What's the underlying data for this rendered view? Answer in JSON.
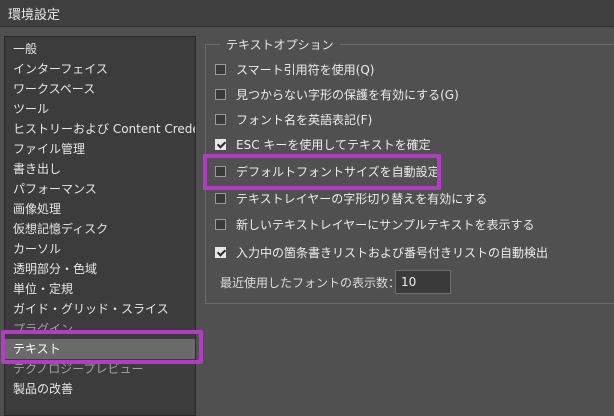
{
  "window": {
    "title": "環境設定"
  },
  "sidebar": {
    "items": [
      {
        "label": "一般"
      },
      {
        "label": "インターフェイス"
      },
      {
        "label": "ワークスペース"
      },
      {
        "label": "ツール"
      },
      {
        "label": "ヒストリーおよび Content Credentials"
      },
      {
        "label": "ファイル管理"
      },
      {
        "label": "書き出し"
      },
      {
        "label": "パフォーマンス"
      },
      {
        "label": "画像処理"
      },
      {
        "label": "仮想記憶ディスク"
      },
      {
        "label": "カーソル"
      },
      {
        "label": "透明部分・色域"
      },
      {
        "label": "単位・定規"
      },
      {
        "label": "ガイド・グリッド・スライス"
      },
      {
        "label": "プラグイン"
      },
      {
        "label": "テキスト"
      },
      {
        "label": "テクノロジープレビュー"
      },
      {
        "label": "製品の改善"
      }
    ],
    "selected_index": 15
  },
  "text_options": {
    "legend": "テキストオプション",
    "options": [
      {
        "label": "スマート引用符を使用(Q)",
        "checked": false
      },
      {
        "label": "見つからない字形の保護を有効にする(G)",
        "checked": false
      },
      {
        "label": "フォント名を英語表記(F)",
        "checked": false
      },
      {
        "label": "ESC キーを使用してテキストを確定",
        "checked": true
      },
      {
        "label": "デフォルトフォントサイズを自動設定",
        "checked": false
      },
      {
        "label": "テキストレイヤーの字形切り替えを有効にする",
        "checked": false
      },
      {
        "label": "新しいテキストレイヤーにサンプルテキストを表示する",
        "checked": false
      },
      {
        "label": "入力中の箇条書きリストおよび番号付きリストの自動検出",
        "checked": true
      }
    ],
    "recent_fonts_label": "最近使用したフォントの表示数：",
    "recent_fonts_value": "10"
  },
  "highlight_color": "#b23cc3"
}
